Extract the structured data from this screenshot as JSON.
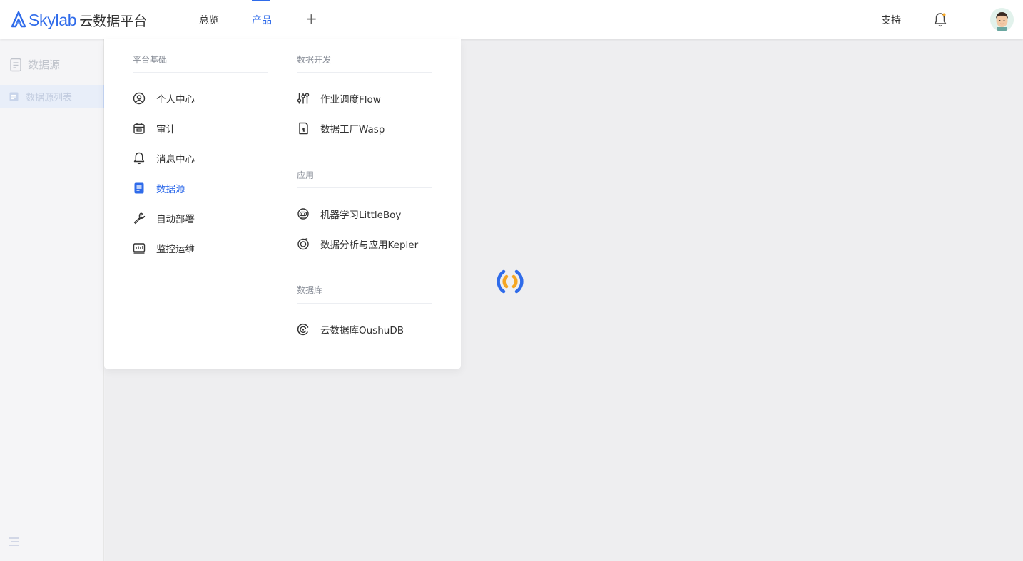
{
  "header": {
    "logo_word": "Skylab",
    "logo_cn": "云数据平台",
    "nav": {
      "overview": "总览",
      "products": "产品",
      "plus": "+"
    },
    "support": "支持",
    "icons": {
      "bell": "bell-icon",
      "avatar": "user-avatar"
    },
    "colors": {
      "brand": "#2f6bea"
    }
  },
  "sidebar": {
    "title": "数据源",
    "active_item": "数据源列表"
  },
  "dropdown": {
    "platform": {
      "title": "平台基础",
      "items": [
        {
          "label": "个人中心",
          "icon": "user-circle-icon"
        },
        {
          "label": "审计",
          "icon": "calendar-icon"
        },
        {
          "label": "消息中心",
          "icon": "bell-icon"
        },
        {
          "label": "数据源",
          "icon": "document-icon",
          "active": true
        },
        {
          "label": "自动部署",
          "icon": "wrench-icon"
        },
        {
          "label": "监控运维",
          "icon": "monitor-chart-icon"
        }
      ]
    },
    "dev": {
      "title": "数据开发",
      "items": [
        {
          "label": "作业调度Flow",
          "icon": "sliders-icon"
        },
        {
          "label": "数据工厂Wasp",
          "icon": "factory-doc-icon"
        }
      ]
    },
    "apps": {
      "title": "应用",
      "items": [
        {
          "label": "机器学习LittleBoy",
          "icon": "robot-icon"
        },
        {
          "label": "数据分析与应用Kepler",
          "icon": "target-icon"
        }
      ]
    },
    "db": {
      "title": "数据库",
      "items": [
        {
          "label": "云数据库OushuDB",
          "icon": "database-swirl-icon"
        }
      ]
    }
  },
  "loading": {
    "spinner_colors": [
      "#2f6bea",
      "#f5a623"
    ]
  }
}
